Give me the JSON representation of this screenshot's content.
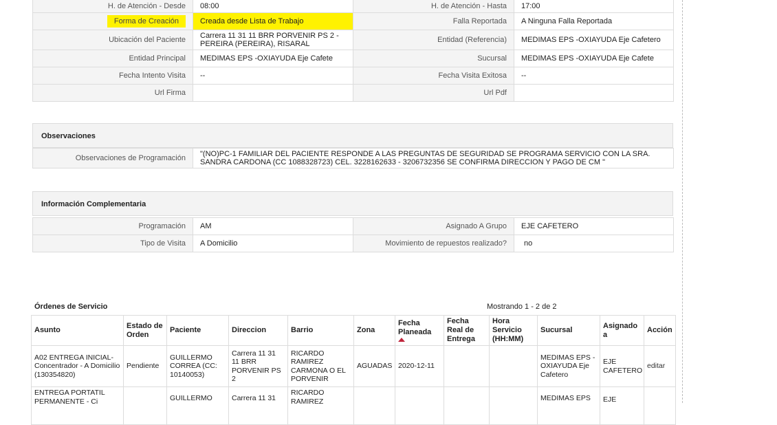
{
  "details": {
    "rows": [
      {
        "l1": "H. de Atención - Desde",
        "v1": "08:00",
        "l2": "H. de Atención - Hasta",
        "v2": "17:00"
      },
      {
        "l1": "Forma de Creación",
        "v1": "Creada desde Lista de Trabajo",
        "l2": "Falla Reportada",
        "v2": "A Ninguna Falla Reportada"
      },
      {
        "l1": "Ubicación del Paciente",
        "v1": "Carrera 11 31 11 BRR PORVENIR PS 2 - PEREIRA (PEREIRA), RISARAL",
        "l2": "Entidad (Referencia)",
        "v2": "MEDIMAS EPS -OXIAYUDA Eje Cafetero"
      },
      {
        "l1": "Entidad Principal",
        "v1": "MEDIMAS EPS -OXIAYUDA Eje Cafete",
        "l2": "Sucursal",
        "v2": "MEDIMAS EPS -OXIAYUDA Eje Cafete"
      },
      {
        "l1": "Fecha Intento Visita",
        "v1": "--",
        "l2": "Fecha Visita Exitosa",
        "v2": "--"
      },
      {
        "l1": "Url Firma",
        "v1": "",
        "l2": "Url Pdf",
        "v2": ""
      }
    ]
  },
  "observaciones": {
    "title": "Observaciones",
    "label": "Observaciones de Programación",
    "value": "\"(NO)PC-1 FAMILIAR DEL PACIENTE RESPONDE A LAS PREGUNTAS DE SEGURIDAD SE PROGRAMA SERVICIO CON LA SRA. SANDRA CARDONA (CC 1088328723) CEL. 3228162633 - 3206732356 SE CONFIRMA DIRECCION Y PAGO DE CM \""
  },
  "complementaria": {
    "title": "Información Complementaria",
    "rows": [
      {
        "l1": "Programación",
        "v1": "AM",
        "l2": "Asignado A Grupo",
        "v2": "EJE CAFETERO"
      },
      {
        "l1": "Tipo de Visita",
        "v1": "A Domicilio",
        "l2": "Movimiento de repuestos realizado?",
        "v2": "no"
      }
    ]
  },
  "ordenes": {
    "title": "Órdenes de Servicio",
    "showing": "Mostrando 1 - 2 de 2",
    "columns": [
      "Asunto",
      "Estado de Orden",
      "Paciente",
      "Direccion",
      "Barrio",
      "Zona",
      "Fecha Planeada",
      "Fecha Real de Entrega",
      "Hora Servicio (HH:MM)",
      "Sucursal",
      "Asignado a",
      "Acción"
    ],
    "rows": [
      {
        "asunto": "A02 ENTREGA INICIAL- Concentrador - A Domicilio (130354820)",
        "estado": "Pendiente",
        "paciente": "GUILLERMO CORREA (CC: 10140053)",
        "direccion": "Carrera 11 31 11 BRR PORVENIR PS 2",
        "barrio": "RICARDO RAMIREZ CARMONA O EL PORVENIR",
        "zona": "AGUADAS",
        "fecha_planeada": "2020-12-11",
        "fecha_real": "",
        "hora": "",
        "sucursal": "MEDIMAS EPS -OXIAYUDA Eje Cafetero",
        "asignado": "EJE CAFETERO",
        "accion": "editar"
      },
      {
        "asunto": "ENTREGA PORTATIL PERMANENTE - Ci",
        "estado": "",
        "paciente": "GUILLERMO",
        "direccion": "Carrera 11 31",
        "barrio": "RICARDO RAMIREZ",
        "zona": "",
        "fecha_planeada": "",
        "fecha_real": "",
        "hora": "",
        "sucursal": "MEDIMAS EPS",
        "asignado": "EJE",
        "accion": ""
      }
    ]
  },
  "colors": {
    "highlight": "#fff200",
    "sort_arrow": "#c0243b"
  }
}
